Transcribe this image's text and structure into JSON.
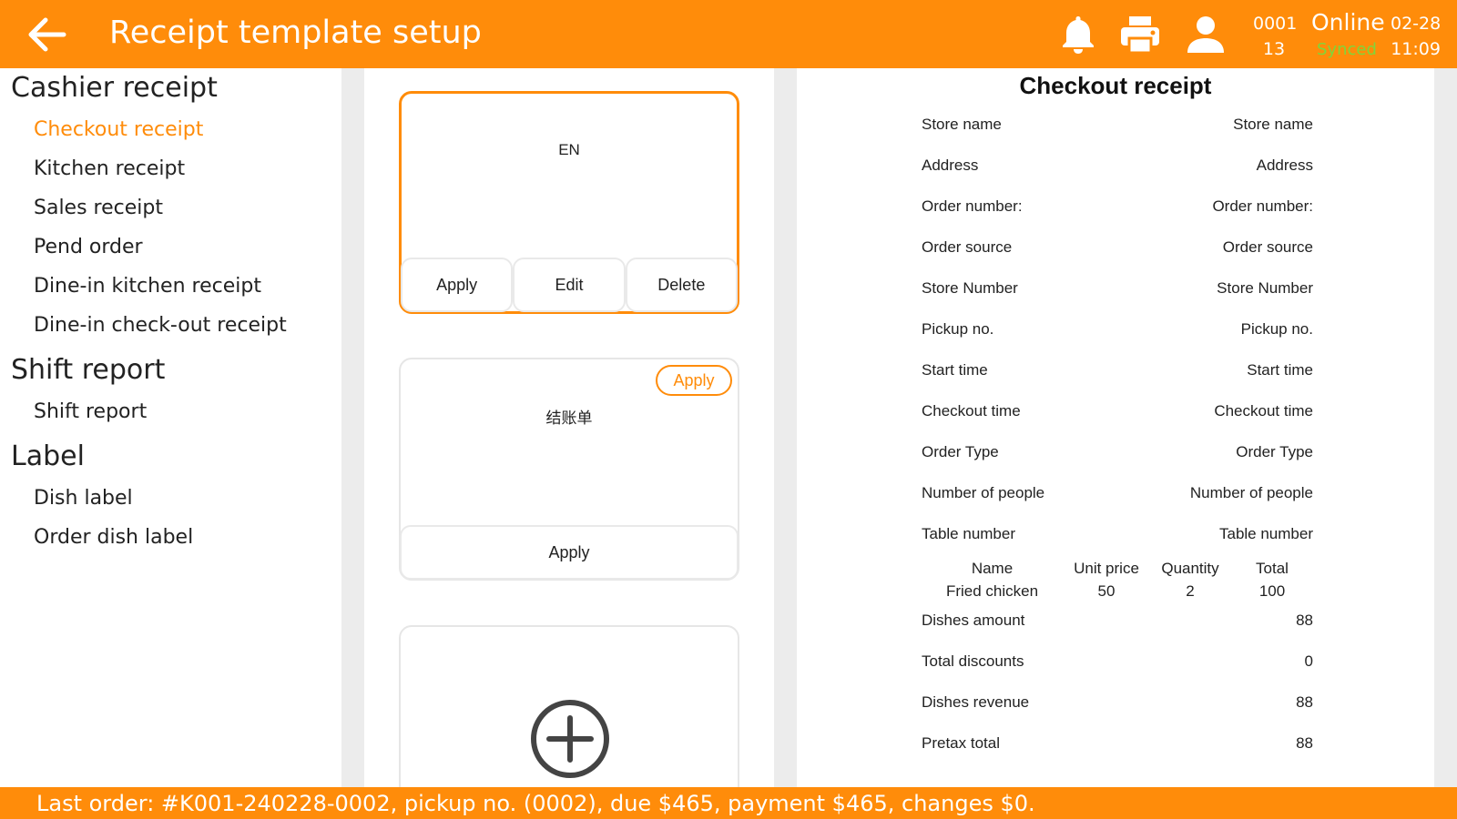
{
  "header": {
    "title": "Receipt template setup",
    "terminal_id_top": "0001",
    "terminal_id_bottom": "13",
    "status": "Online",
    "sync_status": "Synced",
    "date": "02-28",
    "time": "11:09",
    "icons": [
      "back-arrow-icon",
      "bell-icon",
      "printer-icon",
      "user-icon"
    ]
  },
  "sidebar": {
    "categories": [
      {
        "title": "Cashier receipt",
        "items": [
          "Checkout receipt",
          "Kitchen receipt",
          "Sales receipt",
          "Pend order",
          "Dine-in kitchen receipt",
          "Dine-in check-out receipt"
        ]
      },
      {
        "title": "Shift report",
        "items": [
          "Shift report"
        ]
      },
      {
        "title": "Label",
        "items": [
          "Dish label",
          "Order dish label"
        ]
      }
    ],
    "active_item": "Checkout receipt"
  },
  "templates": {
    "cards": [
      {
        "title": "EN",
        "selected": true,
        "buttons": [
          "Apply",
          "Edit",
          "Delete"
        ]
      },
      {
        "title": "结账单",
        "selected": false,
        "badge": "Apply",
        "buttons": [
          "Apply"
        ]
      }
    ],
    "add_icon": "plus-circle-icon"
  },
  "preview": {
    "title": "Checkout receipt",
    "fields": [
      {
        "label": "Store name",
        "value": "Store name"
      },
      {
        "label": "Address",
        "value": "Address"
      },
      {
        "label": "Order number:",
        "value": "Order number:"
      },
      {
        "label": "Order source",
        "value": "Order source"
      },
      {
        "label": "Store Number",
        "value": "Store Number"
      },
      {
        "label": "Pickup no.",
        "value": "Pickup no."
      },
      {
        "label": "Start time",
        "value": "Start time"
      },
      {
        "label": "Checkout time",
        "value": "Checkout time"
      },
      {
        "label": "Order Type",
        "value": "Order Type"
      },
      {
        "label": "Number of people",
        "value": "Number of people"
      },
      {
        "label": "Table number",
        "value": "Table number"
      }
    ],
    "item_table": {
      "headers": [
        "Name",
        "Unit price",
        "Quantity",
        "Total"
      ],
      "rows": [
        [
          "Fried chicken",
          "50",
          "2",
          "100"
        ]
      ]
    },
    "totals": [
      {
        "label": "Dishes amount",
        "value": "88"
      },
      {
        "label": "Total discounts",
        "value": "0"
      },
      {
        "label": "Dishes revenue",
        "value": "88"
      },
      {
        "label": "Pretax total",
        "value": "88"
      }
    ]
  },
  "footer": {
    "text": "Last order: #K001-240228-0002, pickup no. (0002), due $465, payment $465, changes $0."
  },
  "colors": {
    "accent": "#ff8c0a",
    "synced": "#7fd63a"
  }
}
